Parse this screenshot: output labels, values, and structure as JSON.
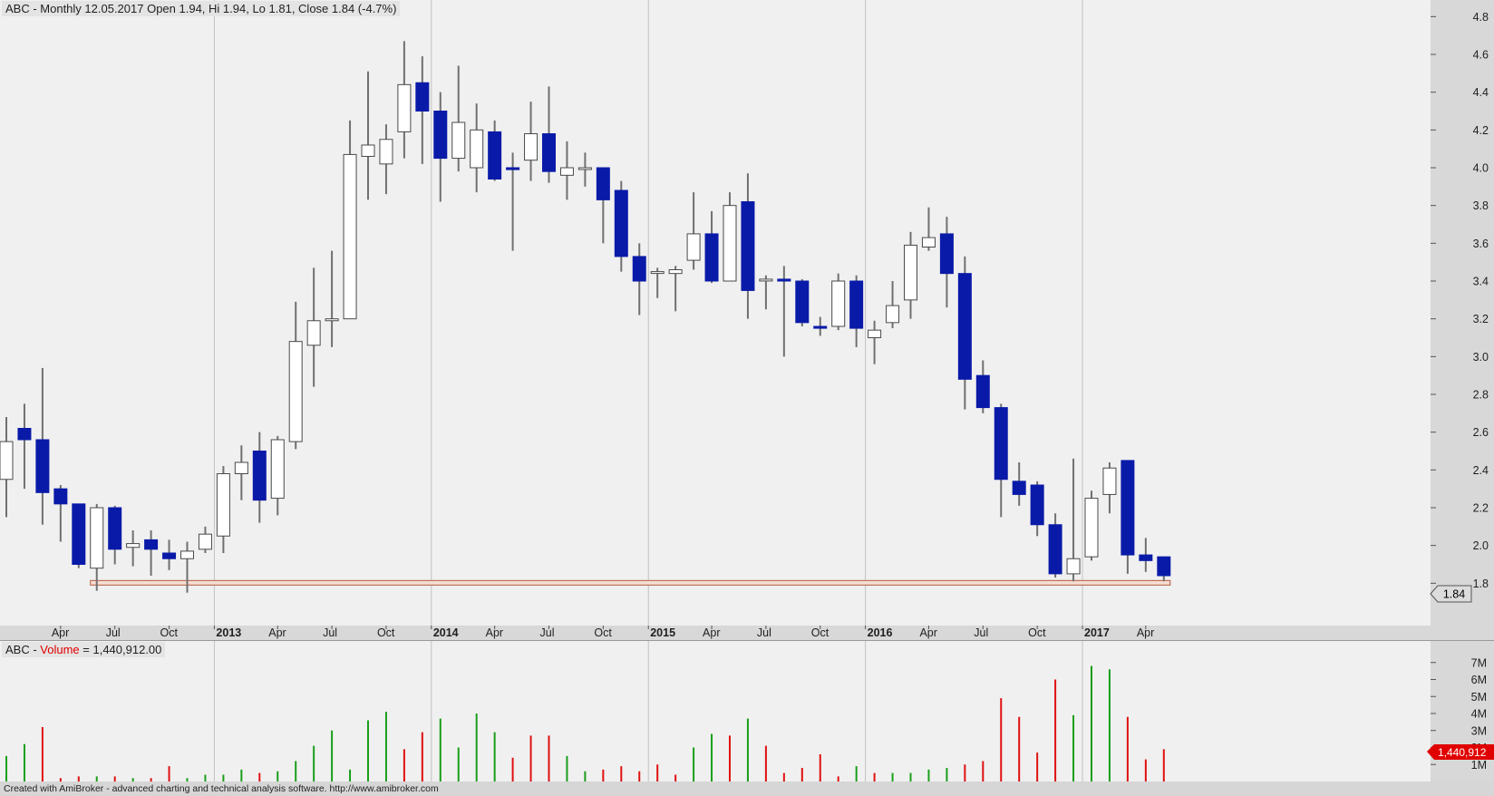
{
  "price_panel": {
    "title": "ABC - Monthly 12.05.2017 Open 1.94, Hi 1.94, Lo 1.81, Close 1.84 (-4.7%)",
    "last_price_label": "1.84"
  },
  "volume_panel": {
    "title_prefix": "ABC - ",
    "title_key": "Volume",
    "title_value": " = 1,440,912.00",
    "last_volume_label": "1,440,912"
  },
  "footer": {
    "text": "Created with AmiBroker - advanced charting and technical analysis software. http://www.amibroker.com"
  },
  "colors": {
    "panel_background": "#f0f0f0",
    "axis_background": "#d8d8d8",
    "up_candle": "#ffffff",
    "down_candle": "#0a1aa8",
    "wick": "#707070",
    "volume_up": "#1a9e1a",
    "volume_down": "#e01010",
    "support_line": "#b55a3c",
    "last_volume_marker": "#e00000"
  },
  "chart_data": [
    {
      "type": "candlestick",
      "title": "ABC - Monthly 12.05.2017 Open 1.94, Hi 1.94, Lo 1.81, Close 1.84 (-4.7%)",
      "x_tick_labels": [
        "Apr",
        "Jul",
        "Oct",
        "2013",
        "Apr",
        "Jul",
        "Oct",
        "2014",
        "Apr",
        "Jul",
        "Oct",
        "2015",
        "Apr",
        "Jul",
        "Oct",
        "2016",
        "Apr",
        "Jul",
        "Oct",
        "2017",
        "Apr"
      ],
      "x_tick_bold": [
        false,
        false,
        false,
        true,
        false,
        false,
        false,
        true,
        false,
        false,
        false,
        true,
        false,
        false,
        false,
        true,
        false,
        false,
        false,
        true,
        false
      ],
      "x_tick_index": [
        3,
        6,
        9,
        12,
        15,
        18,
        21,
        24,
        27,
        30,
        33,
        36,
        39,
        42,
        45,
        48,
        51,
        54,
        57,
        60,
        63
      ],
      "y_ticks": [
        1.8,
        2.0,
        2.2,
        2.4,
        2.6,
        2.8,
        3.0,
        3.2,
        3.4,
        3.6,
        3.8,
        4.0,
        4.2,
        4.4,
        4.6,
        4.8
      ],
      "y_range": [
        1.72,
        4.84
      ],
      "grid": "vertical lines at year starts",
      "support_level": 1.8,
      "bars": [
        {
          "o": 2.35,
          "h": 2.68,
          "l": 2.15,
          "c": 2.55
        },
        {
          "o": 2.62,
          "h": 2.75,
          "l": 2.3,
          "c": 2.56
        },
        {
          "o": 2.56,
          "h": 2.94,
          "l": 2.11,
          "c": 2.28
        },
        {
          "o": 2.3,
          "h": 2.32,
          "l": 2.02,
          "c": 2.22
        },
        {
          "o": 2.22,
          "h": 2.22,
          "l": 1.88,
          "c": 1.9
        },
        {
          "o": 1.88,
          "h": 2.22,
          "l": 1.76,
          "c": 2.2
        },
        {
          "o": 2.2,
          "h": 2.21,
          "l": 1.9,
          "c": 1.98
        },
        {
          "o": 1.99,
          "h": 2.08,
          "l": 1.89,
          "c": 2.01
        },
        {
          "o": 2.03,
          "h": 2.08,
          "l": 1.84,
          "c": 1.98
        },
        {
          "o": 1.96,
          "h": 2.03,
          "l": 1.87,
          "c": 1.93
        },
        {
          "o": 1.93,
          "h": 2.02,
          "l": 1.75,
          "c": 1.97
        },
        {
          "o": 1.98,
          "h": 2.1,
          "l": 1.96,
          "c": 2.06
        },
        {
          "o": 2.05,
          "h": 2.42,
          "l": 1.96,
          "c": 2.38
        },
        {
          "o": 2.38,
          "h": 2.53,
          "l": 2.24,
          "c": 2.44
        },
        {
          "o": 2.5,
          "h": 2.6,
          "l": 2.12,
          "c": 2.24
        },
        {
          "o": 2.25,
          "h": 2.58,
          "l": 2.16,
          "c": 2.56
        },
        {
          "o": 2.55,
          "h": 3.29,
          "l": 2.51,
          "c": 3.08
        },
        {
          "o": 3.06,
          "h": 3.47,
          "l": 2.84,
          "c": 3.19
        },
        {
          "o": 3.19,
          "h": 3.56,
          "l": 3.05,
          "c": 3.2
        },
        {
          "o": 3.2,
          "h": 4.25,
          "l": 3.2,
          "c": 4.07
        },
        {
          "o": 4.06,
          "h": 4.51,
          "l": 3.83,
          "c": 4.12
        },
        {
          "o": 4.02,
          "h": 4.23,
          "l": 3.86,
          "c": 4.15
        },
        {
          "o": 4.19,
          "h": 4.67,
          "l": 4.05,
          "c": 4.44
        },
        {
          "o": 4.45,
          "h": 4.59,
          "l": 4.02,
          "c": 4.3
        },
        {
          "o": 4.3,
          "h": 4.4,
          "l": 3.82,
          "c": 4.05
        },
        {
          "o": 4.05,
          "h": 4.54,
          "l": 3.98,
          "c": 4.24
        },
        {
          "o": 4.0,
          "h": 4.34,
          "l": 3.87,
          "c": 4.2
        },
        {
          "o": 4.19,
          "h": 4.25,
          "l": 3.93,
          "c": 3.94
        },
        {
          "o": 4.0,
          "h": 4.08,
          "l": 3.56,
          "c": 3.99
        },
        {
          "o": 4.04,
          "h": 4.35,
          "l": 3.93,
          "c": 4.18
        },
        {
          "o": 4.18,
          "h": 4.43,
          "l": 3.92,
          "c": 3.98
        },
        {
          "o": 3.96,
          "h": 4.14,
          "l": 3.83,
          "c": 4.0
        },
        {
          "o": 4.0,
          "h": 4.08,
          "l": 3.9,
          "c": 4.0
        },
        {
          "o": 4.0,
          "h": 4.0,
          "l": 3.6,
          "c": 3.83
        },
        {
          "o": 3.88,
          "h": 3.93,
          "l": 3.45,
          "c": 3.53
        },
        {
          "o": 3.53,
          "h": 3.6,
          "l": 3.22,
          "c": 3.4
        },
        {
          "o": 3.45,
          "h": 3.47,
          "l": 3.31,
          "c": 3.45
        },
        {
          "o": 3.44,
          "h": 3.48,
          "l": 3.24,
          "c": 3.46
        },
        {
          "o": 3.51,
          "h": 3.87,
          "l": 3.46,
          "c": 3.65
        },
        {
          "o": 3.65,
          "h": 3.77,
          "l": 3.39,
          "c": 3.4
        },
        {
          "o": 3.4,
          "h": 3.87,
          "l": 3.41,
          "c": 3.8
        },
        {
          "o": 3.82,
          "h": 3.97,
          "l": 3.2,
          "c": 3.35
        },
        {
          "o": 3.41,
          "h": 3.43,
          "l": 3.25,
          "c": 3.41
        },
        {
          "o": 3.41,
          "h": 3.48,
          "l": 3.0,
          "c": 3.4
        },
        {
          "o": 3.4,
          "h": 3.41,
          "l": 3.16,
          "c": 3.18
        },
        {
          "o": 3.16,
          "h": 3.21,
          "l": 3.11,
          "c": 3.15
        },
        {
          "o": 3.16,
          "h": 3.44,
          "l": 3.14,
          "c": 3.4
        },
        {
          "o": 3.4,
          "h": 3.43,
          "l": 3.05,
          "c": 3.15
        },
        {
          "o": 3.1,
          "h": 3.19,
          "l": 2.96,
          "c": 3.14
        },
        {
          "o": 3.18,
          "h": 3.4,
          "l": 3.15,
          "c": 3.27
        },
        {
          "o": 3.3,
          "h": 3.66,
          "l": 3.2,
          "c": 3.59
        },
        {
          "o": 3.58,
          "h": 3.79,
          "l": 3.56,
          "c": 3.63
        },
        {
          "o": 3.65,
          "h": 3.74,
          "l": 3.26,
          "c": 3.44
        },
        {
          "o": 3.44,
          "h": 3.53,
          "l": 2.72,
          "c": 2.88
        },
        {
          "o": 2.9,
          "h": 2.98,
          "l": 2.7,
          "c": 2.73
        },
        {
          "o": 2.73,
          "h": 2.75,
          "l": 2.15,
          "c": 2.35
        },
        {
          "o": 2.34,
          "h": 2.44,
          "l": 2.21,
          "c": 2.27
        },
        {
          "o": 2.32,
          "h": 2.34,
          "l": 2.05,
          "c": 2.11
        },
        {
          "o": 2.11,
          "h": 2.17,
          "l": 1.83,
          "c": 1.85
        },
        {
          "o": 1.85,
          "h": 2.46,
          "l": 1.81,
          "c": 1.93
        },
        {
          "o": 1.94,
          "h": 2.29,
          "l": 1.92,
          "c": 2.25
        },
        {
          "o": 2.27,
          "h": 2.44,
          "l": 2.17,
          "c": 2.41
        },
        {
          "o": 2.45,
          "h": 2.45,
          "l": 1.85,
          "c": 1.95
        },
        {
          "o": 1.95,
          "h": 2.04,
          "l": 1.86,
          "c": 1.92
        },
        {
          "o": 1.94,
          "h": 1.94,
          "l": 1.81,
          "c": 1.84
        }
      ]
    },
    {
      "type": "bar",
      "title": "ABC - Volume = 1,440,912.00",
      "y_tick_labels": [
        "1M",
        "2M",
        "3M",
        "4M",
        "5M",
        "6M",
        "7M"
      ],
      "y_ticks": [
        1,
        2,
        3,
        4,
        5,
        6,
        7
      ],
      "y_unit": "millions",
      "y_range": [
        0,
        7.2
      ],
      "values": [
        1.5,
        2.2,
        3.2,
        0.2,
        0.3,
        0.3,
        0.3,
        0.2,
        0.2,
        0.9,
        0.2,
        0.4,
        0.4,
        0.7,
        0.5,
        0.6,
        1.2,
        2.1,
        3.0,
        0.7,
        3.6,
        4.1,
        1.9,
        2.9,
        3.7,
        2.0,
        4.0,
        2.9,
        1.4,
        2.7,
        2.7,
        1.5,
        0.6,
        0.7,
        0.9,
        0.6,
        1.0,
        0.4,
        2.0,
        2.8,
        2.7,
        3.7,
        2.1,
        0.5,
        0.8,
        1.6,
        0.3,
        0.9,
        0.5,
        0.5,
        0.5,
        0.7,
        0.8,
        1.0,
        1.2,
        4.9,
        3.8,
        1.7,
        6.0,
        3.9,
        6.8,
        6.6,
        3.8,
        1.3,
        1.9
      ],
      "up": [
        true,
        true,
        false,
        false,
        false,
        true,
        false,
        true,
        false,
        false,
        true,
        true,
        true,
        true,
        false,
        true,
        true,
        true,
        true,
        true,
        true,
        true,
        false,
        false,
        true,
        true,
        true,
        true,
        false,
        false,
        false,
        true,
        true,
        false,
        false,
        false,
        false,
        false,
        true,
        true,
        false,
        true,
        false,
        false,
        false,
        false,
        false,
        true,
        false,
        true,
        true,
        true,
        true,
        false,
        false,
        false,
        false,
        false,
        false,
        true,
        true,
        true,
        false,
        false,
        false
      ]
    }
  ]
}
